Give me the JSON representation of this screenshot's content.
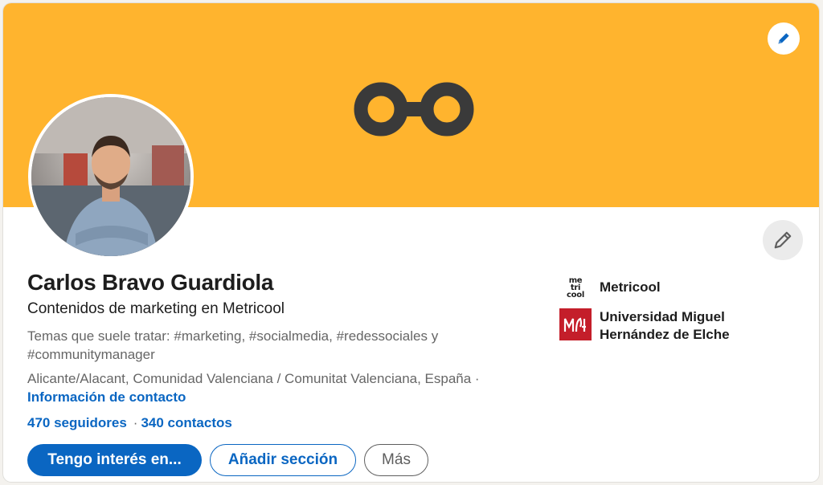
{
  "profile": {
    "name": "Carlos Bravo Guardiola",
    "headline": "Contenidos de marketing en Metricool",
    "topics": "Temas que suele tratar: #marketing, #socialmedia, #redessociales y #communitymanager",
    "location": "Alicante/Alacant, Comunidad Valenciana / Comunitat Valenciana, España ·",
    "contact_link": "Información de contacto",
    "followers": "470 seguidores",
    "connections": "340 contactos",
    "separator": "·"
  },
  "actions": {
    "interest": "Tengo interés en...",
    "add_section": "Añadir sección",
    "more": "Más"
  },
  "companies": [
    {
      "name": "Metricool",
      "logo_text": [
        "me",
        "tri",
        "cool"
      ]
    },
    {
      "name": "Universidad Miguel Hernández de Elche"
    }
  ],
  "icons": {
    "banner_logo": "metricool-infinity-logo",
    "edit_banner": "pencil-icon",
    "edit_intro": "pencil-icon"
  },
  "colors": {
    "banner": "#ffb42e",
    "accent": "#0a66c2",
    "umh": "#c41e2a"
  }
}
